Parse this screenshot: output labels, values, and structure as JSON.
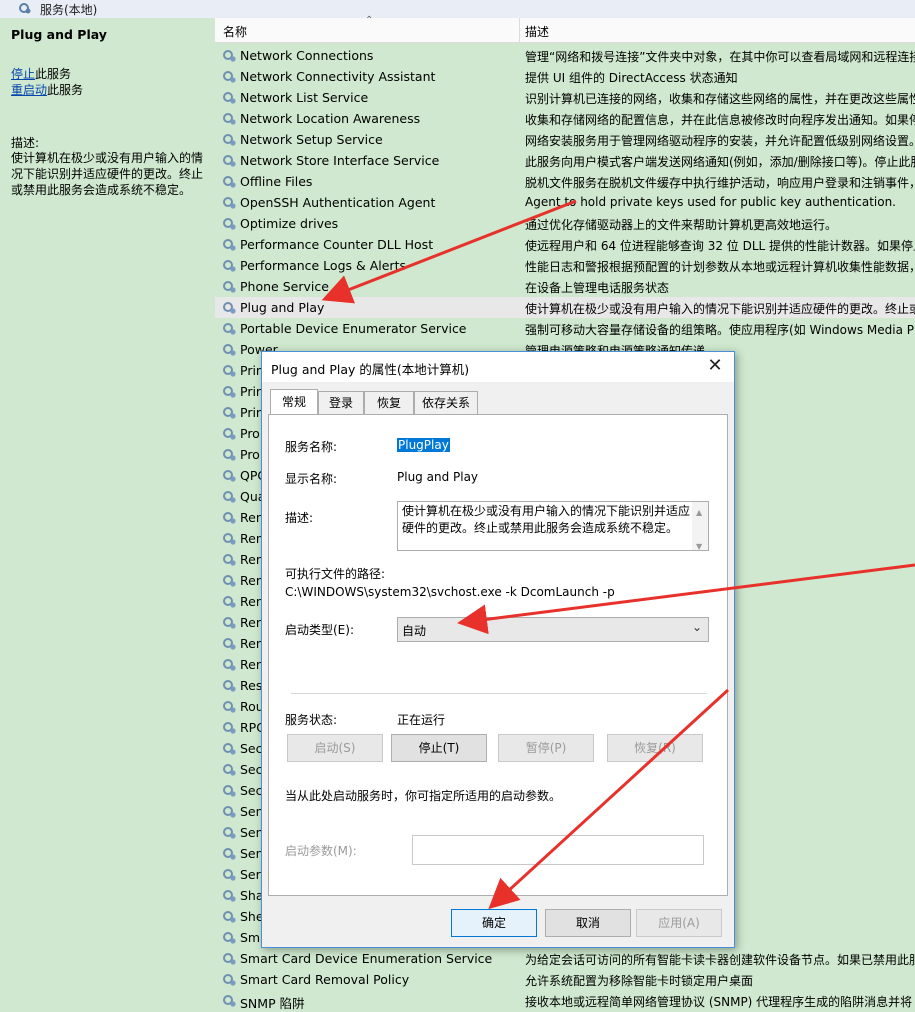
{
  "window": {
    "title": "服务(本地)"
  },
  "left_panel": {
    "service_name": "Plug and Play",
    "stop_link": "停止",
    "stop_suffix": "此服务",
    "restart_link": "重启动",
    "restart_suffix": "此服务",
    "desc_label": "描述:",
    "description": "使计算机在极少或没有用户输入的情况下能识别并适应硬件的更改。终止或禁用此服务会造成系统不稳定。"
  },
  "list": {
    "col_name": "名称",
    "col_desc": "描述",
    "rows": [
      {
        "name": "Network Connections",
        "desc": "管理“网络和拨号连接”文件夹中对象，在其中你可以查看局域网和远程连接"
      },
      {
        "name": "Network Connectivity Assistant",
        "desc": "提供 UI 组件的 DirectAccess 状态通知"
      },
      {
        "name": "Network List Service",
        "desc": "识别计算机已连接的网络，收集和存储这些网络的属性，并在更改这些属性"
      },
      {
        "name": "Network Location Awareness",
        "desc": "收集和存储网络的配置信息，并在此信息被修改时向程序发出通知。如果停"
      },
      {
        "name": "Network Setup Service",
        "desc": "网络安装服务用于管理网络驱动程序的安装，并允许配置低级别网络设置。"
      },
      {
        "name": "Network Store Interface Service",
        "desc": "此服务向用户模式客户端发送网络通知(例如，添加/删除接口等)。停止此服"
      },
      {
        "name": "Offline Files",
        "desc": "脱机文件服务在脱机文件缓存中执行维护活动，响应用户登录和注销事件，"
      },
      {
        "name": "OpenSSH Authentication Agent",
        "desc": "Agent to hold private keys used for public key authentication."
      },
      {
        "name": "Optimize drives",
        "desc": "通过优化存储驱动器上的文件来帮助计算机更高效地运行。"
      },
      {
        "name": "Performance Counter DLL Host",
        "desc": "使远程用户和 64 位进程能够查询 32 位 DLL 提供的性能计数器。如果停止"
      },
      {
        "name": "Performance Logs & Alerts",
        "desc": "性能日志和警报根据预配置的计划参数从本地或远程计算机收集性能数据，"
      },
      {
        "name": "Phone Service",
        "desc": "在设备上管理电话服务状态"
      },
      {
        "name": "Plug and Play",
        "desc": "使计算机在极少或没有用户输入的情况下能识别并适应硬件的更改。终止或"
      },
      {
        "name": "Portable Device Enumerator Service",
        "desc": "强制可移动大容量存储设备的组策略。使应用程序(如 Windows Media Pla"
      },
      {
        "name": "Power",
        "desc": "管理电源策略和电源策略通知传递。"
      },
      {
        "name": "Prin",
        "desc": "印机的交互。如果关闭该服务，则无"
      },
      {
        "name": "Prin",
        "desc": "理来自远程打印服务器或打印机的通"
      },
      {
        "name": "Prin",
        "desc": ""
      },
      {
        "name": "Pro",
        "desc": "解决方案”控制面板的系统级问题报"
      },
      {
        "name": "Pro",
        "desc": "务。PCA 监视由用户安装和运行的程"
      },
      {
        "name": "QPC",
        "desc": ""
      },
      {
        "name": "Qua",
        "desc": "是用于 IP 家庭网络上的音频视频(AV)"
      },
      {
        "name": "Ren",
        "desc": "的 DNS 或者 NetBIOS 名称或者地址"
      },
      {
        "name": "Ren",
        "desc": "建网络的拨号和虚拟专用网络(VPN)"
      },
      {
        "name": "Ren",
        "desc": "STEM 上下文的所有远程桌面服务和"
      },
      {
        "name": "Ren",
        "desc": "，远程桌面和远程桌面会话主机服务"
      },
      {
        "name": "Ren",
        "desc": "序/端口"
      },
      {
        "name": "Ren",
        "desc": "的服务控制管理器。它执行 COM 和"
      },
      {
        "name": "Ren",
        "desc": "期版本中，远程过程调用(RPC)定位"
      },
      {
        "name": "Ren",
        "desc": "设置。如果此服务被终止，只有此计"
      },
      {
        "name": "Res",
        "desc": "以应用目标用户或计算机的组策略设"
      },
      {
        "name": "Rou",
        "desc": "路由服务。"
      },
      {
        "name": "RPC",
        "desc": "果此服务被停止或禁用，使用远程过"
      },
      {
        "name": "Sec",
        "desc": "务被停止，这种类型的登录访问将不"
      },
      {
        "name": "Sec",
        "desc": "全套接字隧道协议(SSTP)的支持。如"
      },
      {
        "name": "Sec",
        "desc": "全帐户管理器(SAM)已准备就绪，可"
      },
      {
        "name": "Sen",
        "desc": ""
      },
      {
        "name": "Sen",
        "desc": "统和用户状态。如果此服务停止或禁"
      },
      {
        "name": "Sen",
        "desc": "服务。管理传感器的简单设备方向(S"
      },
      {
        "name": "Serv",
        "desc": "和命名管道共享。如果服务停止，这"
      },
      {
        "name": "Shar",
        "desc": "a SharedPC configured device"
      },
      {
        "name": "She",
        "desc": ""
      },
      {
        "name": "Sma",
        "desc": "果此服务被终止，此计算机将无法取"
      },
      {
        "name": "Smart Card Device Enumeration Service",
        "desc": "为给定会话可访问的所有智能卡读卡器创建软件设备节点。如果已禁用此服"
      },
      {
        "name": "Smart Card Removal Policy",
        "desc": "允许系统配置为移除智能卡时锁定用户桌面"
      },
      {
        "name": "SNMP 陷阱",
        "desc": "接收本地或远程简单网络管理协议 (SNMP) 代理程序生成的陷阱消息并将"
      }
    ]
  },
  "dialog": {
    "title": "Plug and Play 的属性(本地计算机)",
    "close_glyph": "✕",
    "tabs": [
      "常规",
      "登录",
      "恢复",
      "依存关系"
    ],
    "service_name_label": "服务名称:",
    "service_name_value": "PlugPlay",
    "display_name_label": "显示名称:",
    "display_name_value": "Plug and Play",
    "desc_label": "描述:",
    "description": "使计算机在极少或没有用户输入的情况下能识别并适应硬件的更改。终止或禁用此服务会造成系统不稳定。",
    "path_label": "可执行文件的路径:",
    "path_value": "C:\\WINDOWS\\system32\\svchost.exe -k DcomLaunch -p",
    "startup_label": "启动类型(E):",
    "startup_value": "自动",
    "status_label": "服务状态:",
    "status_value": "正在运行",
    "btn_start": "启动(S)",
    "btn_stop": "停止(T)",
    "btn_pause": "暂停(P)",
    "btn_resume": "恢复(R)",
    "hint": "当从此处启动服务时，你可指定所适用的启动参数。",
    "param_label": "启动参数(M):",
    "btn_ok": "确定",
    "btn_cancel": "取消",
    "btn_apply": "应用(A)"
  },
  "colors": {
    "panel_bg": "#cfe8cf",
    "selection": "#0078d7",
    "annotation_arrow": "#e8312a"
  }
}
